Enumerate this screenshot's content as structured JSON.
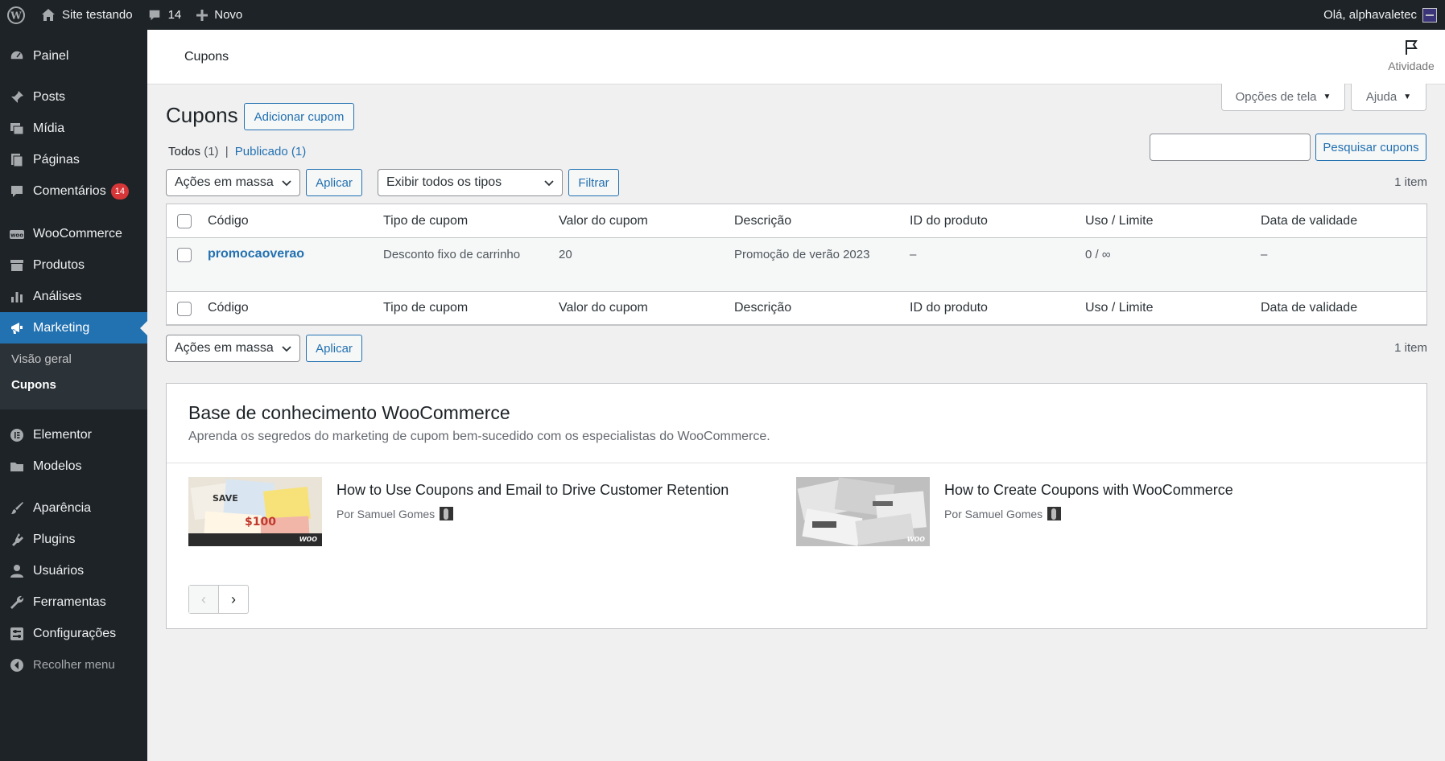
{
  "adminbar": {
    "site_name": "Site testando",
    "comments_count": "14",
    "new_label": "Novo",
    "greeting": "Olá, alphavaletec"
  },
  "sidebar": {
    "items": [
      {
        "label": "Painel",
        "icon": "dashboard-icon"
      },
      {
        "label": "Posts",
        "icon": "pin-icon"
      },
      {
        "label": "Mídia",
        "icon": "media-icon"
      },
      {
        "label": "Páginas",
        "icon": "pages-icon"
      },
      {
        "label": "Comentários",
        "icon": "comment-icon",
        "badge": "14"
      },
      {
        "label": "WooCommerce",
        "icon": "woo-icon"
      },
      {
        "label": "Produtos",
        "icon": "archive-icon"
      },
      {
        "label": "Análises",
        "icon": "chart-icon"
      },
      {
        "label": "Marketing",
        "icon": "megaphone-icon"
      },
      {
        "label": "Elementor",
        "icon": "elementor-icon"
      },
      {
        "label": "Modelos",
        "icon": "folder-icon"
      },
      {
        "label": "Aparência",
        "icon": "brush-icon"
      },
      {
        "label": "Plugins",
        "icon": "plugin-icon"
      },
      {
        "label": "Usuários",
        "icon": "user-icon"
      },
      {
        "label": "Ferramentas",
        "icon": "wrench-icon"
      },
      {
        "label": "Configurações",
        "icon": "settings-icon"
      },
      {
        "label": "Recolher menu",
        "icon": "collapse-icon"
      }
    ],
    "submenu": [
      {
        "label": "Visão geral"
      },
      {
        "label": "Cupons"
      }
    ]
  },
  "header": {
    "breadcrumb": "Cupons",
    "activity_label": "Atividade"
  },
  "screen_options": {
    "options_label": "Opções de tela",
    "help_label": "Ajuda"
  },
  "page": {
    "title": "Cupons",
    "add_button": "Adicionar cupom",
    "filters": {
      "all_label": "Todos",
      "all_count": "(1)",
      "separator": "|",
      "published_label": "Publicado",
      "published_count": "(1)"
    },
    "search_button": "Pesquisar cupons",
    "search_value": "",
    "bulk_action": "Ações em massa",
    "apply_label": "Aplicar",
    "type_filter": "Exibir todos os tipos",
    "filter_button": "Filtrar",
    "items_count": "1 item"
  },
  "table": {
    "columns": [
      "Código",
      "Tipo de cupom",
      "Valor do cupom",
      "Descrição",
      "ID do produto",
      "Uso / Limite",
      "Data de validade"
    ],
    "rows": [
      {
        "code": "promocaoverao",
        "type": "Desconto fixo de carrinho",
        "value": "20",
        "description": "Promoção de verão 2023",
        "product_id": "–",
        "usage": "0 / ∞",
        "expiry": "–"
      }
    ]
  },
  "knowledge_base": {
    "title": "Base de conhecimento WooCommerce",
    "subtitle": "Aprenda os segredos do marketing de cupom bem-sucedido com os especialistas do WooCommerce.",
    "articles": [
      {
        "title": "How to Use Coupons and Email to Drive Customer Retention",
        "author": "Por Samuel Gomes",
        "thumb_text": "SAVE $100 woo"
      },
      {
        "title": "How to Create Coupons with WooCommerce",
        "author": "Por Samuel Gomes",
        "thumb_text": "woo"
      }
    ],
    "pager": {
      "prev": "‹",
      "next": "›"
    }
  },
  "colors": {
    "admin_dark": "#1d2327",
    "accent_blue": "#2271b1",
    "badge_red": "#d63638"
  }
}
